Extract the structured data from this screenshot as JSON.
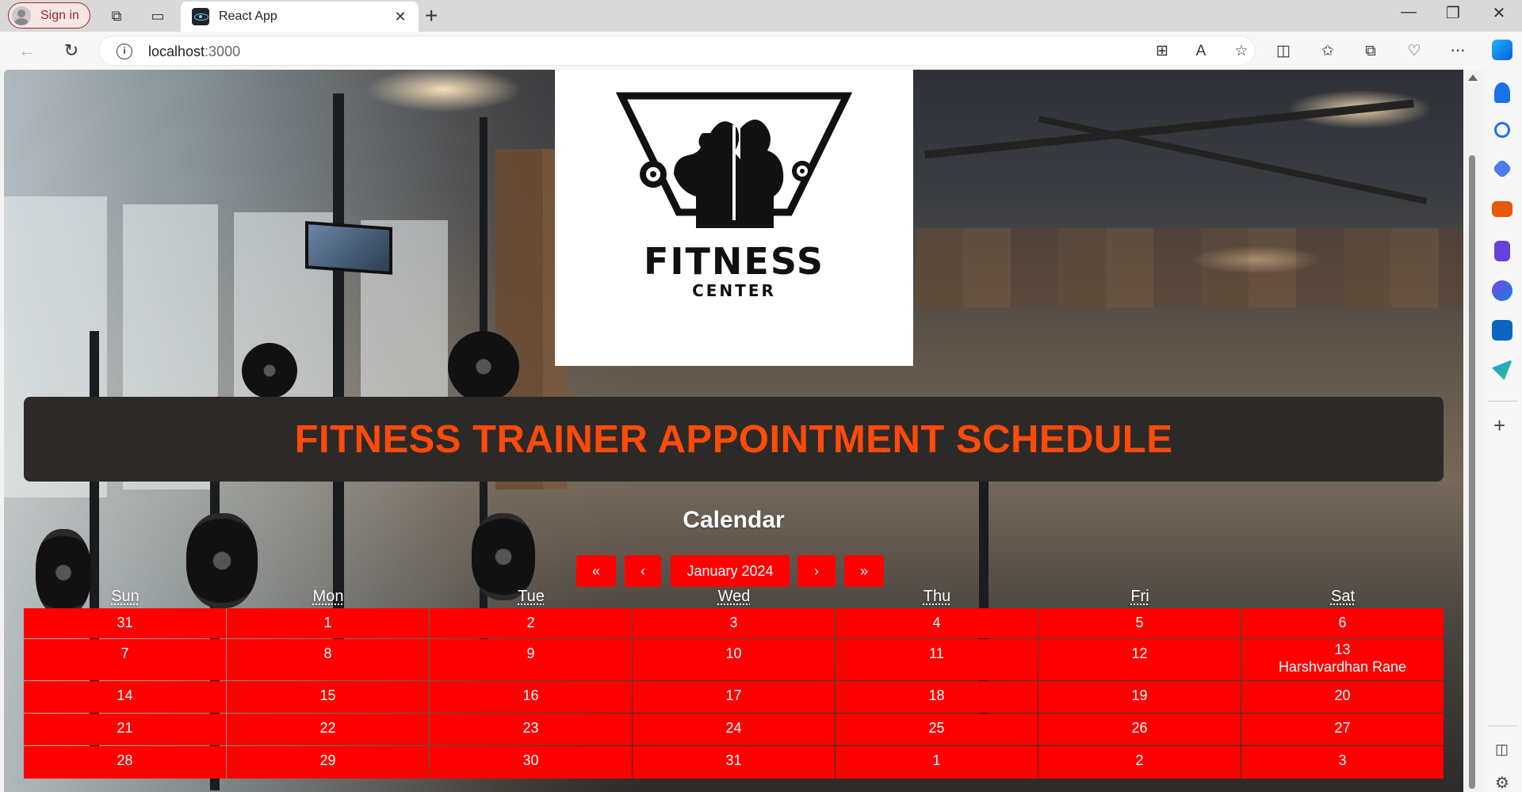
{
  "browser": {
    "signin_label": "Sign in",
    "tab_title": "React App",
    "url_host": "localhost",
    "url_port": ":3000"
  },
  "page": {
    "logo_title": "FITNESS",
    "logo_subtitle": "CENTER",
    "heading": "FITNESS TRAINER APPOINTMENT SCHEDULE",
    "calendar_title": "Calendar"
  },
  "calendar": {
    "month_label": "January 2024",
    "nav": {
      "prev_year": "«",
      "prev_month": "‹",
      "next_month": "›",
      "next_year": "»"
    },
    "weekdays": [
      "Sun",
      "Mon",
      "Tue",
      "Wed",
      "Thu",
      "Fri",
      "Sat"
    ],
    "weeks": [
      [
        {
          "d": "31"
        },
        {
          "d": "1"
        },
        {
          "d": "2"
        },
        {
          "d": "3"
        },
        {
          "d": "4"
        },
        {
          "d": "5"
        },
        {
          "d": "6"
        }
      ],
      [
        {
          "d": "7"
        },
        {
          "d": "8"
        },
        {
          "d": "9"
        },
        {
          "d": "10"
        },
        {
          "d": "11"
        },
        {
          "d": "12"
        },
        {
          "d": "13",
          "event": "Harshvardhan Rane"
        }
      ],
      [
        {
          "d": "14"
        },
        {
          "d": "15"
        },
        {
          "d": "16"
        },
        {
          "d": "17"
        },
        {
          "d": "18"
        },
        {
          "d": "19"
        },
        {
          "d": "20"
        }
      ],
      [
        {
          "d": "21"
        },
        {
          "d": "22"
        },
        {
          "d": "23"
        },
        {
          "d": "24"
        },
        {
          "d": "25"
        },
        {
          "d": "26"
        },
        {
          "d": "27"
        }
      ],
      [
        {
          "d": "28"
        },
        {
          "d": "29"
        },
        {
          "d": "30"
        },
        {
          "d": "31"
        },
        {
          "d": "1"
        },
        {
          "d": "2"
        },
        {
          "d": "3"
        }
      ]
    ]
  },
  "colors": {
    "accent_red": "#ff0000",
    "heading_orange": "#ff4a0a",
    "banner_bg": "#2b2a28"
  }
}
